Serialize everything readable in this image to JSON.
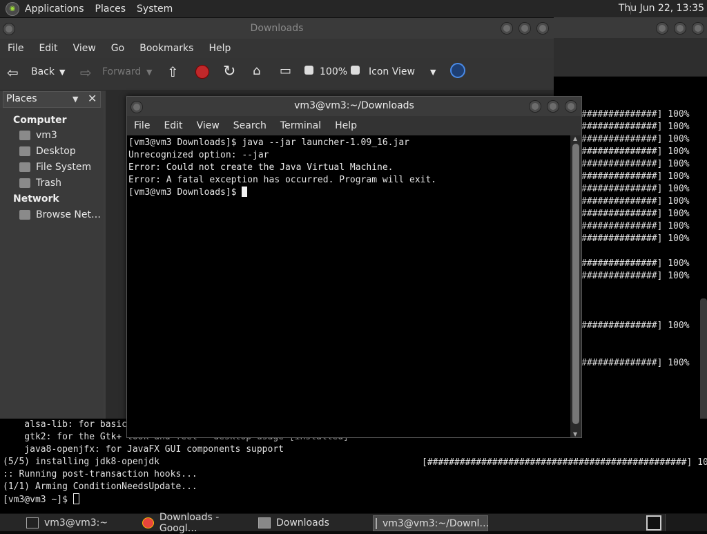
{
  "top_panel": {
    "menus": [
      "Applications",
      "Places",
      "System"
    ],
    "clock": "Thu Jun 22, 13:35"
  },
  "file_manager": {
    "title": "Downloads",
    "menu": [
      "File",
      "Edit",
      "View",
      "Go",
      "Bookmarks",
      "Help"
    ],
    "toolbar": {
      "back": "Back",
      "forward": "Forward",
      "zoom": "100%",
      "view_mode": "Icon View"
    },
    "sidebar": {
      "header": "Places",
      "computer_label": "Computer",
      "computer_items": [
        "vm3",
        "Desktop",
        "File System",
        "Trash"
      ],
      "network_label": "Network",
      "network_items": [
        "Browse Net…"
      ]
    }
  },
  "terminal": {
    "title": "vm3@vm3:~/Downloads",
    "menu": [
      "File",
      "Edit",
      "View",
      "Search",
      "Terminal",
      "Help"
    ],
    "lines": [
      "[vm3@vm3 Downloads]$ java --jar launcher-1.09_16.jar",
      "Unrecognized option: --jar",
      "Error: Could not create the Java Virtual Machine.",
      "Error: A fatal exception has occurred. Program will exit.",
      "[vm3@vm3 Downloads]$ "
    ]
  },
  "background_terminal": {
    "progress_rows": [
      "##############] 100%",
      "##############] 100%",
      "##############] 100%",
      "##############] 100%",
      "##############] 100%",
      "##############] 100%",
      "##############] 100%",
      "##############] 100%",
      "##############] 100%",
      "##############] 100%",
      "##############] 100%",
      "",
      "##############] 100%",
      "##############] 100%",
      "",
      "",
      "",
      "##############] 100%",
      "",
      "",
      "##############] 100%"
    ],
    "bottom_lines": [
      "    alsa-lib: for basic",
      "    gtk2: for the Gtk+ look and feel - desktop usage [installed]",
      "    java8-openjfx: for JavaFX GUI components support",
      "(5/5) installing jdk8-openjdk",
      ":: Running post-transaction hooks...",
      "(1/1) Arming ConditionNeedsUpdate...",
      "[vm3@vm3 ~]$ "
    ],
    "progress_line": "[################################################] 100%"
  },
  "taskbar": {
    "items": [
      "vm3@vm3:~",
      "Downloads - Googl…",
      "Downloads",
      "vm3@vm3:~/Downl…"
    ]
  }
}
